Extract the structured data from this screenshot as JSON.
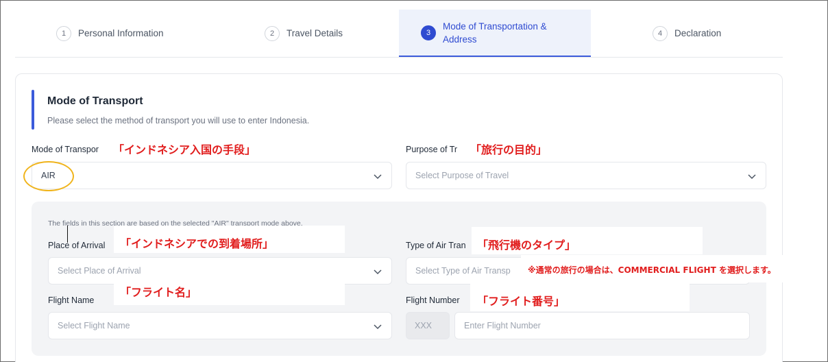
{
  "stepper": {
    "steps": [
      {
        "num": "1",
        "label": "Personal Information"
      },
      {
        "num": "2",
        "label": "Travel Details"
      },
      {
        "num": "3",
        "label": "Mode of Transportation & Address"
      },
      {
        "num": "4",
        "label": "Declaration"
      }
    ],
    "active_step": 3
  },
  "section": {
    "title": "Mode of Transport",
    "subtitle": "Please select the method of transport you will use to enter Indonesia."
  },
  "fields": {
    "mode_of_transport": {
      "label": "Mode of Transpor",
      "value": "AIR"
    },
    "purpose_of_travel": {
      "label": "Purpose of Tr",
      "placeholder": "Select Purpose of Travel"
    },
    "sub_note": "The fields in this section are based on the selected \"AIR\" transport mode above.",
    "place_of_arrival": {
      "label": "Place of Arrival",
      "placeholder": "Select Place of Arrival"
    },
    "type_of_air_transport": {
      "label": "Type of Air Tran",
      "placeholder": "Select Type of Air Transp"
    },
    "flight_name": {
      "label": "Flight Name",
      "placeholder": "Select Flight Name"
    },
    "flight_number": {
      "label": "Flight Number",
      "prefix": "XXX",
      "placeholder": "Enter Flight Number"
    }
  },
  "annotations": {
    "mode_of_transport": "「インドネシア入国の手段」",
    "purpose_of_travel": "「旅行の目的」",
    "place_of_arrival": "「インドネシアでの到着場所」",
    "type_of_air_transport": "「飛行機のタイプ」",
    "commercial_note": "※通常の旅行の場合は、COMMERCIAL FLIGHT を選択します。",
    "flight_name": "「フライト名」",
    "flight_number": "「フライト番号」"
  },
  "colors": {
    "accent": "#2f4bd1",
    "annotation": "#e11d1d",
    "highlight_circle": "#f0b41c"
  },
  "icons": {
    "dropdown": "chevron-down-icon"
  }
}
